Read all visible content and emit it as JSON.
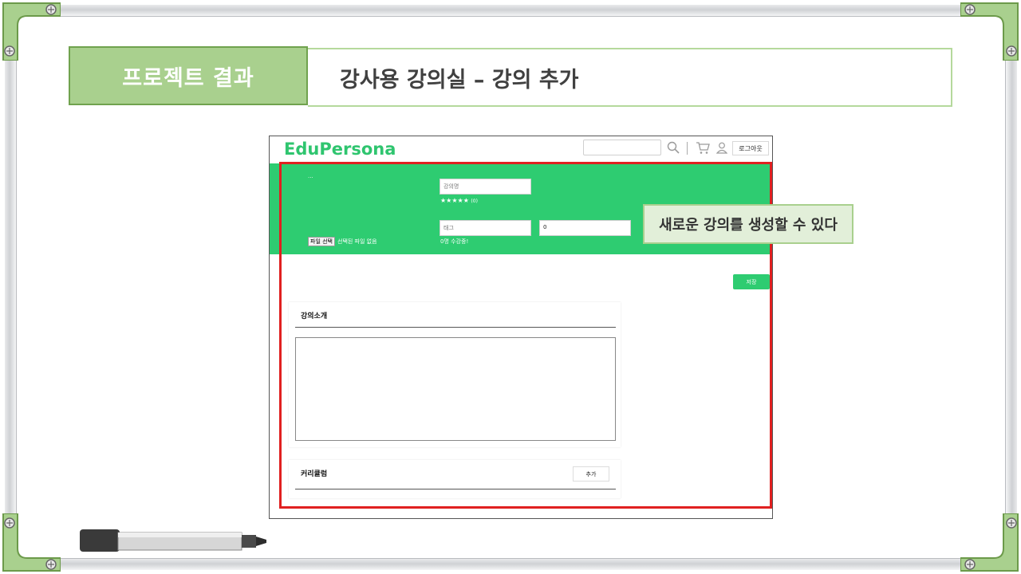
{
  "slide": {
    "section_title": "프로젝트 결과",
    "subtitle": "강사용 강의실 – 강의 추가",
    "callout": "새로운 강의를 생성할 수 있다"
  },
  "app": {
    "brand": "EduPersona",
    "logout_label": "로그아웃",
    "thumbnail_alt": "...",
    "name_placeholder": "강의명",
    "rating_stars": "★★★★★",
    "rating_count": "(0)",
    "tag_placeholder": "태그",
    "price_value": "0",
    "learners_text": "0명 수강중!",
    "file_button": "파일 선택",
    "file_status": "선택된 파일 없음",
    "save_label": "저장",
    "intro_title": "강의소개",
    "curriculum_title": "커리큘럼",
    "add_label": "추가"
  },
  "colors": {
    "accent": "#2ecc71",
    "highlight": "#e02020",
    "title_fill": "#a9d08e"
  },
  "icons": [
    "search-icon",
    "cart-icon",
    "user-icon"
  ]
}
